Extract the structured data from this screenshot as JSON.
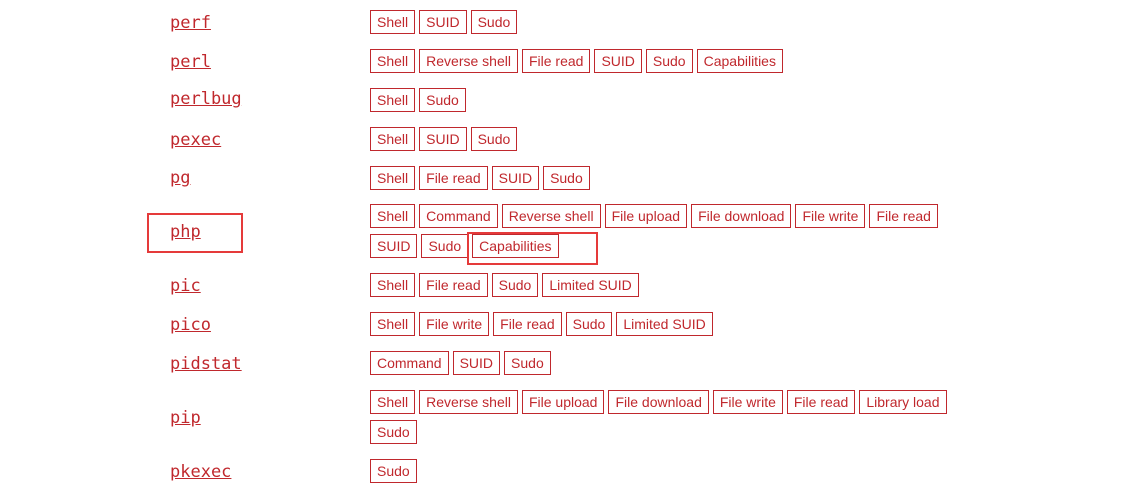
{
  "colors": {
    "accent": "#c0282d",
    "highlight": "#e53a3a"
  },
  "binaries": [
    {
      "name": "perf",
      "functions": [
        "Shell",
        "SUID",
        "Sudo"
      ]
    },
    {
      "name": "perl",
      "functions": [
        "Shell",
        "Reverse shell",
        "File read",
        "SUID",
        "Sudo",
        "Capabilities"
      ]
    },
    {
      "name": "perlbug",
      "functions": [
        "Shell",
        "Sudo"
      ]
    },
    {
      "name": "pexec",
      "functions": [
        "Shell",
        "SUID",
        "Sudo"
      ]
    },
    {
      "name": "pg",
      "functions": [
        "Shell",
        "File read",
        "SUID",
        "Sudo"
      ]
    },
    {
      "name": "php",
      "functions": [
        "Shell",
        "Command",
        "Reverse shell",
        "File upload",
        "File download",
        "File write",
        "File read",
        "SUID",
        "Sudo",
        "Capabilities"
      ]
    },
    {
      "name": "pic",
      "functions": [
        "Shell",
        "File read",
        "Sudo",
        "Limited SUID"
      ]
    },
    {
      "name": "pico",
      "functions": [
        "Shell",
        "File write",
        "File read",
        "Sudo",
        "Limited SUID"
      ]
    },
    {
      "name": "pidstat",
      "functions": [
        "Command",
        "SUID",
        "Sudo"
      ]
    },
    {
      "name": "pip",
      "functions": [
        "Shell",
        "Reverse shell",
        "File upload",
        "File download",
        "File write",
        "File read",
        "Library load",
        "Sudo"
      ]
    },
    {
      "name": "pkexec",
      "functions": [
        "Sudo"
      ]
    }
  ]
}
